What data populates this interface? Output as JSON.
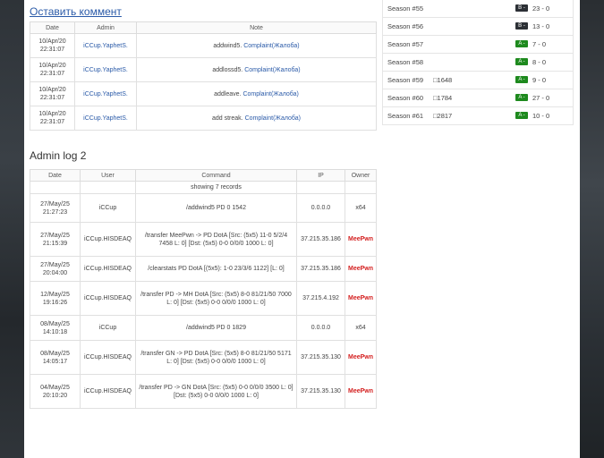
{
  "comments": {
    "title": "Оставить коммент",
    "headers": [
      "Date",
      "Admin",
      "Note"
    ],
    "rows": [
      {
        "date": "10/Apr/20",
        "time": "22:31:07",
        "admin": "iCCup.YaphetS.",
        "note": "addwind5.",
        "link": "Complaint(Жалоба)"
      },
      {
        "date": "10/Apr/20",
        "time": "22:31:07",
        "admin": "iCCup.YaphetS.",
        "note": "addlossd5.",
        "link": "Complaint(Жалоба)"
      },
      {
        "date": "10/Apr/20",
        "time": "22:31:07",
        "admin": "iCCup.YaphetS.",
        "note": "addleave.",
        "link": "Complaint(Жалоба)"
      },
      {
        "date": "10/Apr/20",
        "time": "22:31:07",
        "admin": "iCCup.YaphetS.",
        "note": "add streak.",
        "link": "Complaint(Жалоба)"
      }
    ]
  },
  "adminlog": {
    "title": "Admin log 2",
    "headers": [
      "Date",
      "User",
      "Command",
      "IP",
      "Owner"
    ],
    "showing": "showing 7 records",
    "rows": [
      {
        "date": "27/May/25",
        "time": "21:27:23",
        "user": "iCCup",
        "command": "/addwind5 PD 0 1542",
        "ip": "0.0.0.0",
        "owner": "x64",
        "owner_red": false
      },
      {
        "date": "27/May/25",
        "time": "21:15:39",
        "user": "iCCup.HISDEAQ",
        "command": "/transfer MeePwn -> PD DotA [Src: (5x5) 11-0 5/2/4 7458 L: 0] [Dst: (5x5) 0-0 0/0/0 1000 L: 0]",
        "ip": "37.215.35.186",
        "owner": "MeePwn",
        "owner_red": true
      },
      {
        "date": "27/May/25",
        "time": "20:04:00",
        "user": "iCCup.HISDEAQ",
        "command": "/clearstats PD DotA [(5x5): 1-0 23/3/6 1122] [L: 0]",
        "ip": "37.215.35.186",
        "owner": "MeePwn",
        "owner_red": true
      },
      {
        "date": "12/May/25",
        "time": "19:16:26",
        "user": "iCCup.HISDEAQ",
        "command": "/transfer PD -> MH DotA [Src: (5x5) 8-0 81/21/50 7000 L: 0] [Dst: (5x5) 0-0 0/0/0 1000 L: 0]",
        "ip": "37.215.4.192",
        "owner": "MeePwn",
        "owner_red": true
      },
      {
        "date": "08/May/25",
        "time": "14:10:18",
        "user": "iCCup",
        "command": "/addwind5 PD 0 1829",
        "ip": "0.0.0.0",
        "owner": "x64",
        "owner_red": false
      },
      {
        "date": "08/May/25",
        "time": "14:05:17",
        "user": "iCCup.HISDEAQ",
        "command": "/transfer GN -> PD DotA [Src: (5x5) 8-0 81/21/50 5171 L: 0] [Dst: (5x5) 0-0 0/0/0 1000 L: 0]",
        "ip": "37.215.35.130",
        "owner": "MeePwn",
        "owner_red": true
      },
      {
        "date": "04/May/25",
        "time": "20:10:20",
        "user": "iCCup.HISDEAQ",
        "command": "/transfer PD -> GN DotA [Src: (5x5) 0-0 0/0/0 3500 L: 0] [Dst: (5x5) 0-0 0/0/0 1000 L: 0]",
        "ip": "37.215.35.130",
        "owner": "MeePwn",
        "owner_red": true
      }
    ]
  },
  "seasons": [
    {
      "name": "Season #55",
      "extra": "",
      "badge": "B -",
      "grade": "B",
      "score": "23 - 0"
    },
    {
      "name": "Season #56",
      "extra": "",
      "badge": "B -",
      "grade": "B",
      "score": "13 - 0"
    },
    {
      "name": "Season #57",
      "extra": "",
      "badge": "A -",
      "grade": "A",
      "score": "7 - 0"
    },
    {
      "name": "Season #58",
      "extra": "",
      "badge": "A -",
      "grade": "A",
      "score": "8 - 0"
    },
    {
      "name": "Season #59",
      "extra": "□1648",
      "badge": "A -",
      "grade": "A",
      "score": "9 - 0"
    },
    {
      "name": "Season #60",
      "extra": "□1784",
      "badge": "A -",
      "grade": "A",
      "score": "27 - 0"
    },
    {
      "name": "Season #61",
      "extra": "□2817",
      "badge": "A -",
      "grade": "A",
      "score": "10 - 0"
    }
  ]
}
